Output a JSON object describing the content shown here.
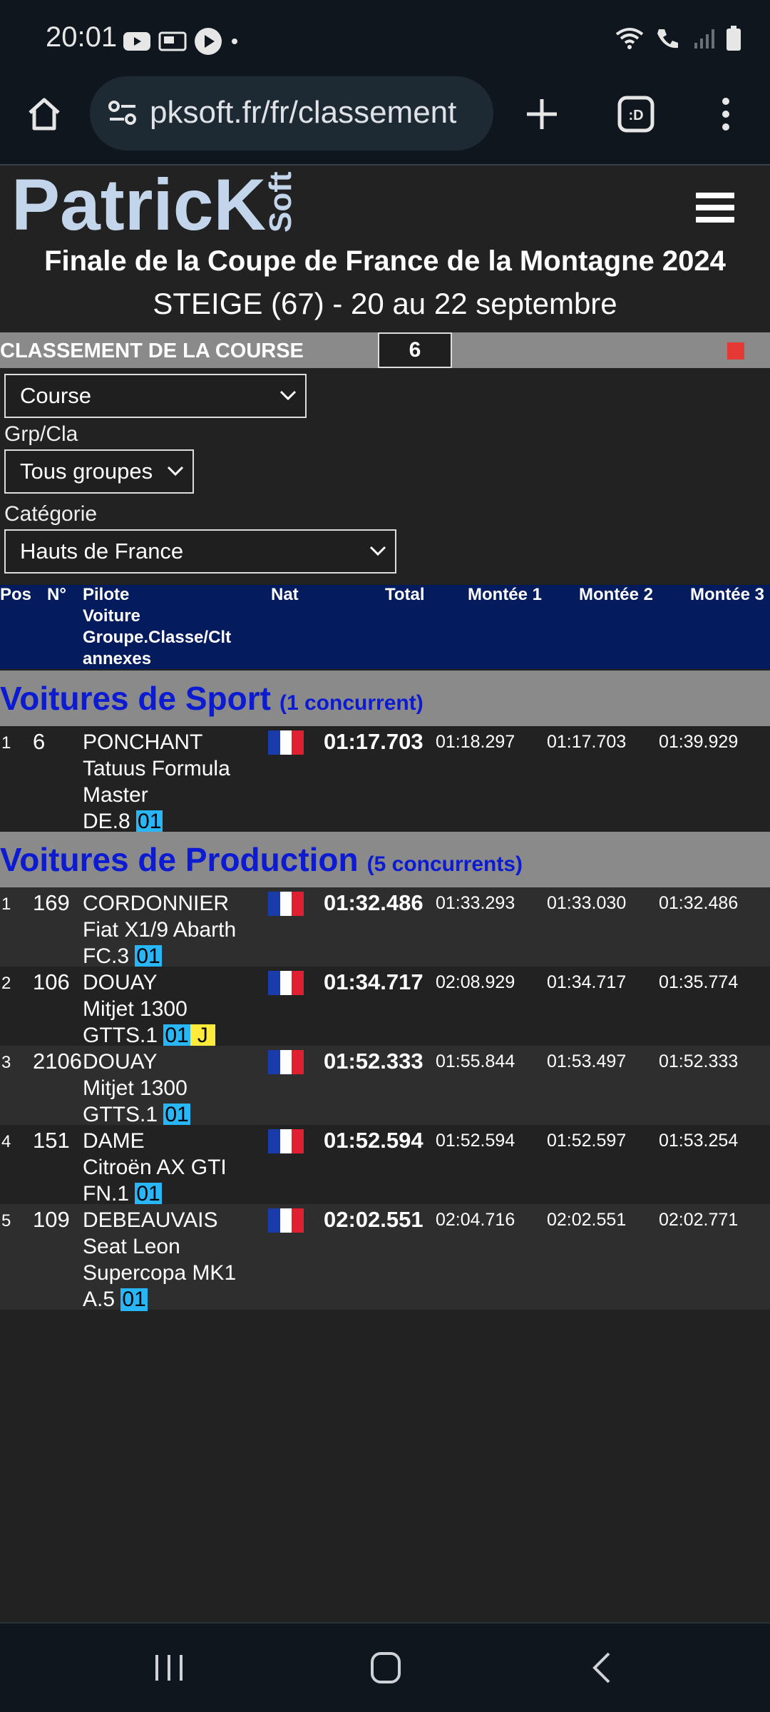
{
  "status": {
    "time": "20:01"
  },
  "browser": {
    "url": "pksoft.fr/fr/classement"
  },
  "site": {
    "logo": {
      "text_main": "PatricK",
      "text_side": "Soft"
    },
    "title": "Finale de la Coupe de France de la Montagne 2024",
    "subtitle": "STEIGE (67) - 20 au 22 septembre"
  },
  "classement": {
    "label": "CLASSEMENT DE LA COURSE",
    "number": "6"
  },
  "filters": {
    "course": "Course",
    "grp_label": "Grp/Cla",
    "grp_value": "Tous groupes",
    "cat_label": "Catégorie",
    "cat_value": "Hauts de France"
  },
  "table_header": {
    "pos": "Pos",
    "no": "N°",
    "pilote": [
      "Pilote",
      "Voiture",
      "Groupe.Classe/Clt",
      "annexes"
    ],
    "nat": "Nat",
    "total": "Total",
    "m1": "Montée 1",
    "m2": "Montée 2",
    "m3": "Montée 3"
  },
  "groups": [
    {
      "name": "Voitures de Sport",
      "count": "(1 concurrent)"
    },
    {
      "name": "Voitures de Production",
      "count": "(5 concurrents)"
    }
  ],
  "rows": [
    {
      "pos": "1",
      "no": "6",
      "pilote": "PONCHANT",
      "voiture1": "Tatuus Formula",
      "voiture2": "Master",
      "classe": "DE.8",
      "badge": "01",
      "total": "01:17.703",
      "m1": "01:18.297",
      "m2": "01:17.703",
      "m3": "01:39.929"
    },
    {
      "pos": "1",
      "no": "169",
      "pilote": "CORDONNIER",
      "voiture1": "Fiat X1/9 Abarth",
      "classe": "FC.3",
      "badge": "01",
      "total": "01:32.486",
      "m1": "01:33.293",
      "m2": "01:33.030",
      "m3": "01:32.486"
    },
    {
      "pos": "2",
      "no": "106",
      "pilote": "DOUAY",
      "voiture1": "Mitjet 1300",
      "classe": "GTTS.1",
      "badge": "01",
      "badge2": "J",
      "total": "01:34.717",
      "m1": "02:08.929",
      "m2": "01:34.717",
      "m3": "01:35.774"
    },
    {
      "pos": "3",
      "no": "2106",
      "pilote": "DOUAY",
      "voiture1": "Mitjet 1300",
      "classe": "GTTS.1",
      "badge": "01",
      "total": "01:52.333",
      "m1": "01:55.844",
      "m2": "01:53.497",
      "m3": "01:52.333"
    },
    {
      "pos": "4",
      "no": "151",
      "pilote": "DAME",
      "voiture1": "Citroën AX GTI",
      "classe": "FN.1",
      "badge": "01",
      "total": "01:52.594",
      "m1": "01:52.594",
      "m2": "01:52.597",
      "m3": "01:53.254"
    },
    {
      "pos": "5",
      "no": "109",
      "pilote": "DEBEAUVAIS",
      "voiture1": "Seat Leon",
      "voiture2": "Supercopa MK1",
      "classe": "A.5",
      "badge": "01",
      "total": "02:02.551",
      "m1": "02:04.716",
      "m2": "02:02.551",
      "m3": "02:02.771"
    }
  ],
  "colors": {
    "header_blue": "#041b5e",
    "group_text": "#0c1bd1",
    "badge_blue": "#29b6f6",
    "badge_yellow": "#ffeb3b"
  }
}
